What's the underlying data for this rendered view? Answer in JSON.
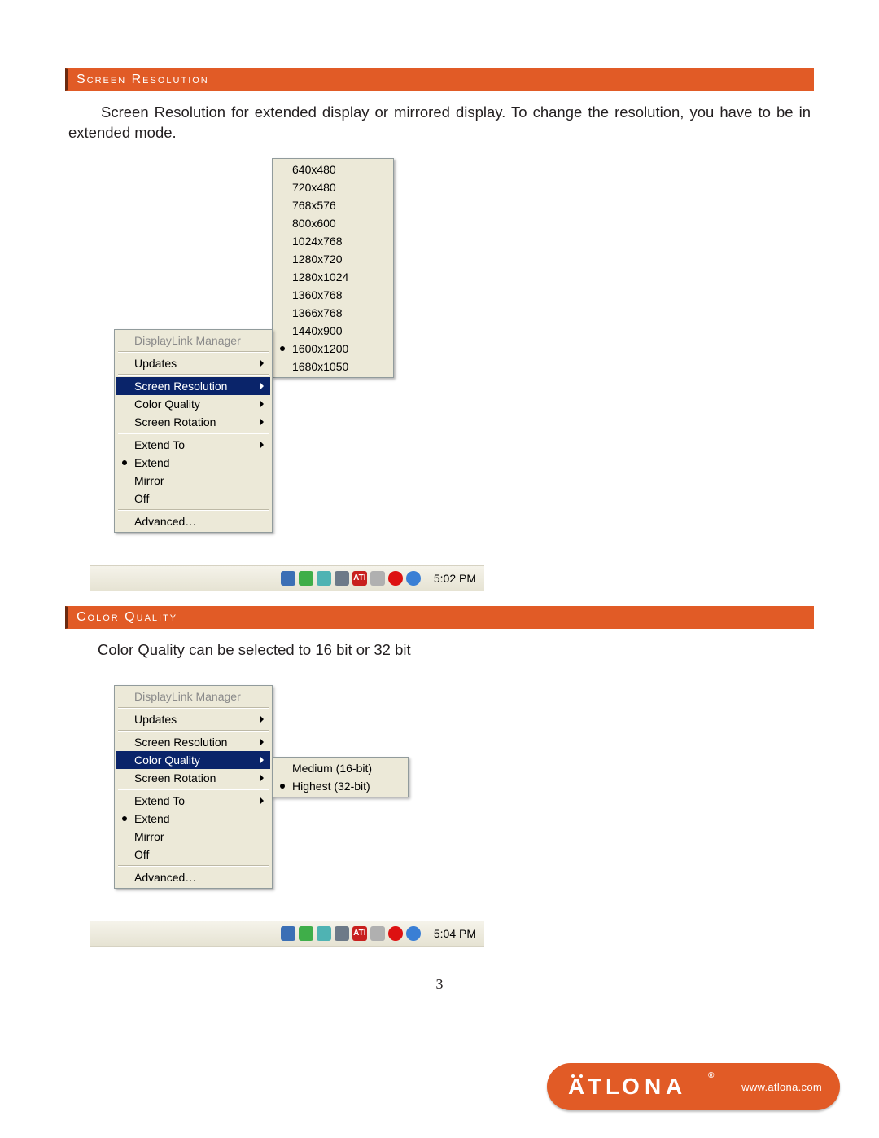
{
  "section1": {
    "header": "Screen Resolution",
    "paragraph": "Screen Resolution for extended display or mirrored display. To change the resolution, you have to be in extended mode.",
    "menu": {
      "title": "DisplayLink Manager",
      "items": [
        {
          "label": "Updates",
          "submenu": true
        },
        {
          "sep": true
        },
        {
          "label": "Screen Resolution",
          "submenu": true,
          "selected": true
        },
        {
          "label": "Color Quality",
          "submenu": true
        },
        {
          "label": "Screen Rotation",
          "submenu": true
        },
        {
          "sep": true
        },
        {
          "label": "Extend To",
          "submenu": true
        },
        {
          "label": "Extend",
          "radio": true
        },
        {
          "label": "Mirror"
        },
        {
          "label": "Off"
        },
        {
          "sep": true
        },
        {
          "label": "Advanced…"
        }
      ],
      "resolutions": [
        "640x480",
        "720x480",
        "768x576",
        "800x600",
        "1024x768",
        "1280x720",
        "1280x1024",
        "1360x768",
        "1366x768",
        "1440x900",
        "1600x1200",
        "1680x1050"
      ],
      "resolutions_selected_index": 10,
      "clock": "5:02 PM"
    }
  },
  "section2": {
    "header": "Color Quality",
    "paragraph": "Color Quality can be selected to 16 bit or 32 bit",
    "menu": {
      "title": "DisplayLink Manager",
      "items": [
        {
          "label": "Updates",
          "submenu": true
        },
        {
          "sep": true
        },
        {
          "label": "Screen Resolution",
          "submenu": true
        },
        {
          "label": "Color Quality",
          "submenu": true,
          "selected": true
        },
        {
          "label": "Screen Rotation",
          "submenu": true
        },
        {
          "sep": true
        },
        {
          "label": "Extend To",
          "submenu": true
        },
        {
          "label": "Extend",
          "radio": true
        },
        {
          "label": "Mirror"
        },
        {
          "label": "Off"
        },
        {
          "sep": true
        },
        {
          "label": "Advanced…"
        }
      ],
      "color_quality": [
        {
          "label": "Medium (16-bit)"
        },
        {
          "label": "Highest (32-bit)",
          "radio": true
        }
      ],
      "clock": "5:04 PM"
    }
  },
  "tray_icon_names": [
    "flag",
    "green",
    "teal",
    "msn",
    "ati",
    "silver",
    "red-ball",
    "globe"
  ],
  "page_number": "3",
  "footer": {
    "brand": "ATLONA",
    "url": "www.atlona.com"
  }
}
